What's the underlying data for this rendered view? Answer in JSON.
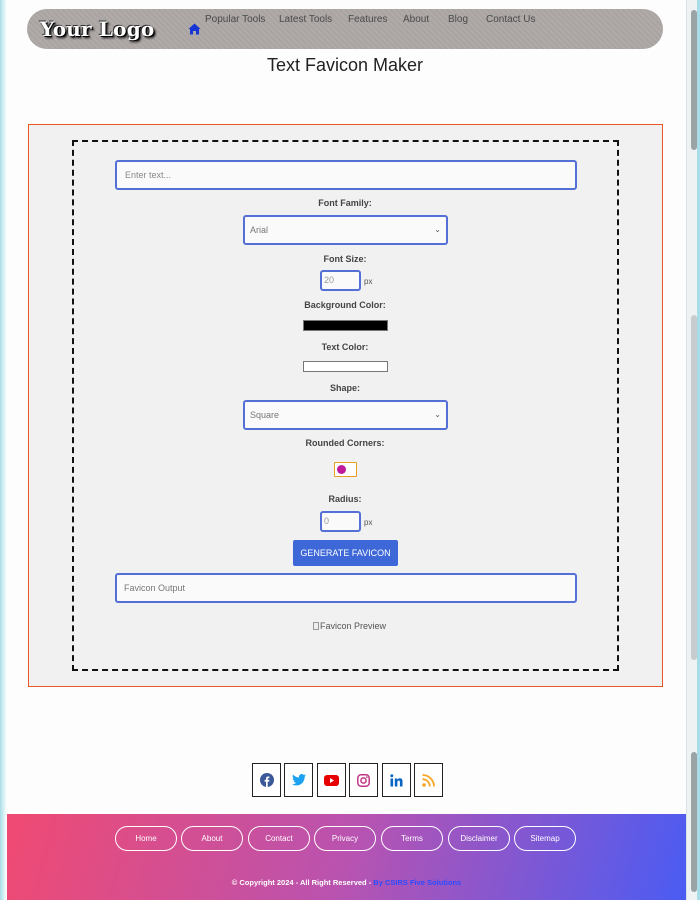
{
  "nav": {
    "logo": "Your Logo",
    "home_icon": "home-icon",
    "links": [
      "Popular Tools",
      "Latest Tools",
      "Features",
      "About",
      "Blog",
      "Contact Us"
    ]
  },
  "page_title": "Text Favicon Maker",
  "form": {
    "text_placeholder": "Enter text...",
    "font_family_label": "Font Family:",
    "font_family_value": "Arial",
    "font_size_label": "Font Size:",
    "font_size_value": "20",
    "px_unit": "px",
    "bg_color_label": "Background Color:",
    "bg_color": "#000000",
    "text_color_label": "Text Color:",
    "text_color": "#ffffff",
    "shape_label": "Shape:",
    "shape_value": "Square",
    "rounded_label": "Rounded Corners:",
    "radius_label": "Radius:",
    "radius_value": "0",
    "generate_label": "GENERATE FAVICON",
    "output_placeholder": "Favicon Output",
    "preview_alt": "Favicon Preview"
  },
  "social": [
    "facebook-icon",
    "twitter-icon",
    "youtube-icon",
    "instagram-icon",
    "linkedin-icon",
    "rss-icon"
  ],
  "footer": {
    "links": [
      "Home",
      "About",
      "Contact",
      "Privacy",
      "Terms",
      "Disclaimer",
      "Sitemap"
    ],
    "copyright": "© Copyright 2024 - All Right Reserved - ",
    "brand": "By CSIRS Five Solutions"
  },
  "colors": {
    "accent": "#3e68d8",
    "outer_border": "#e8562a",
    "footer_start": "#f04a72",
    "footer_end": "#4a5cf3"
  }
}
